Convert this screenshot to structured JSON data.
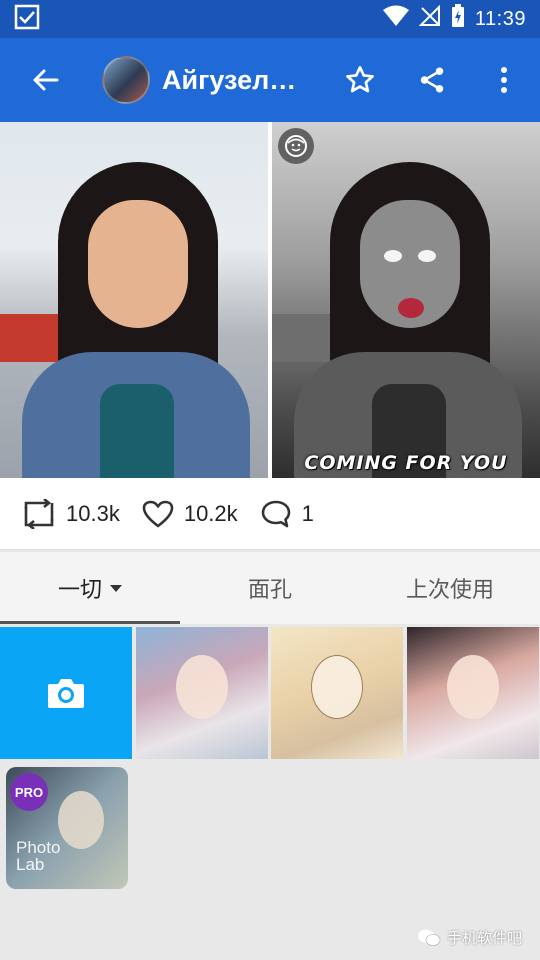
{
  "status_bar": {
    "time": "11:39"
  },
  "app_bar": {
    "title": "Айгузель Ы..."
  },
  "hero": {
    "caption": "COMING FOR YOU"
  },
  "stats": {
    "reposts": "10.3k",
    "likes": "10.2k",
    "comments": "1"
  },
  "tabs": [
    {
      "label": "一切"
    },
    {
      "label": "面孔"
    },
    {
      "label": "上次使用"
    }
  ],
  "pro_tile": {
    "badge": "PRO",
    "label_line1": "Photo",
    "label_line2": "Lab"
  },
  "watermark": {
    "text": "手机软件吧"
  },
  "colors": {
    "status_bar": "#1a56b8",
    "app_bar": "#1f6ad6",
    "camera_tile": "#0aa6f5"
  }
}
